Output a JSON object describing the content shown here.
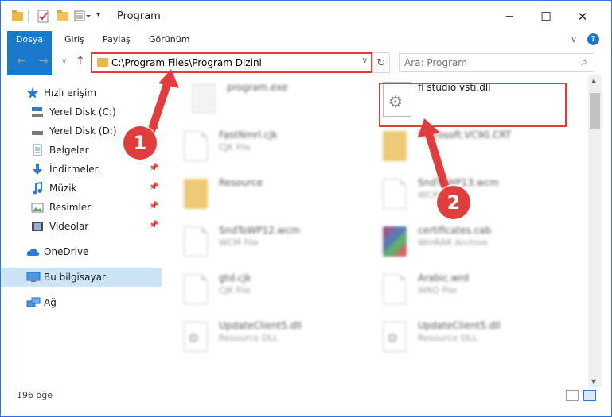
{
  "window": {
    "title": "Program",
    "minimize": "─",
    "maximize": "☐",
    "close": "✕"
  },
  "ribbon": {
    "tabs": [
      "Dosya",
      "Giriş",
      "Paylaş",
      "Görünüm"
    ],
    "collapse": "∨",
    "help": "?"
  },
  "address": {
    "path": "C:\\Program Files\\Program Dizini",
    "dropdown": "∨",
    "refresh": "↻"
  },
  "search": {
    "placeholder": "Ara: Program"
  },
  "navigation": {
    "back": "←",
    "forward": "→",
    "recent": "∨",
    "up": "↑"
  },
  "sidebar": {
    "quick_access": "Hızlı erişim",
    "items": [
      {
        "label": "Yerel Disk (C:)"
      },
      {
        "label": "Yerel Disk (D:)"
      },
      {
        "label": "Belgeler"
      },
      {
        "label": "İndirmeler"
      },
      {
        "label": "Müzik"
      },
      {
        "label": "Resimler"
      },
      {
        "label": "Videolar"
      }
    ],
    "onedrive": "OneDrive",
    "this_pc": "Bu bilgisayar",
    "network": "Ağ"
  },
  "files": [
    {
      "name": "program.exe",
      "type": ""
    },
    {
      "name": "fl studio vsti.dll",
      "type": ""
    },
    {
      "name": "FastNmrl.cjk",
      "type": "CJK File"
    },
    {
      "name": "Microsoft.VC90.CRT",
      "type": ""
    },
    {
      "name": "Resource",
      "type": ""
    },
    {
      "name": "SndToWP13.wcm",
      "type": "WCM File"
    },
    {
      "name": "SndToWP12.wcm",
      "type": "WCM File"
    },
    {
      "name": "certificates.cab",
      "type": "WinRAR Archive"
    },
    {
      "name": "gtd.cjk",
      "type": "CJK File"
    },
    {
      "name": "Arabic.wrd",
      "type": "WRD File"
    },
    {
      "name": "UpdateClient5.dll",
      "type": "Resource DLL"
    },
    {
      "name": "UpdateClient5.dll",
      "type": "Resource DLL"
    }
  ],
  "status": {
    "count": "196 öğe"
  },
  "annotations": {
    "step1": "1",
    "step2": "2"
  },
  "colors": {
    "accent": "#1979ca",
    "highlight": "#e23d3d",
    "folder": "#e9b84a",
    "selected": "#cce4f7"
  }
}
